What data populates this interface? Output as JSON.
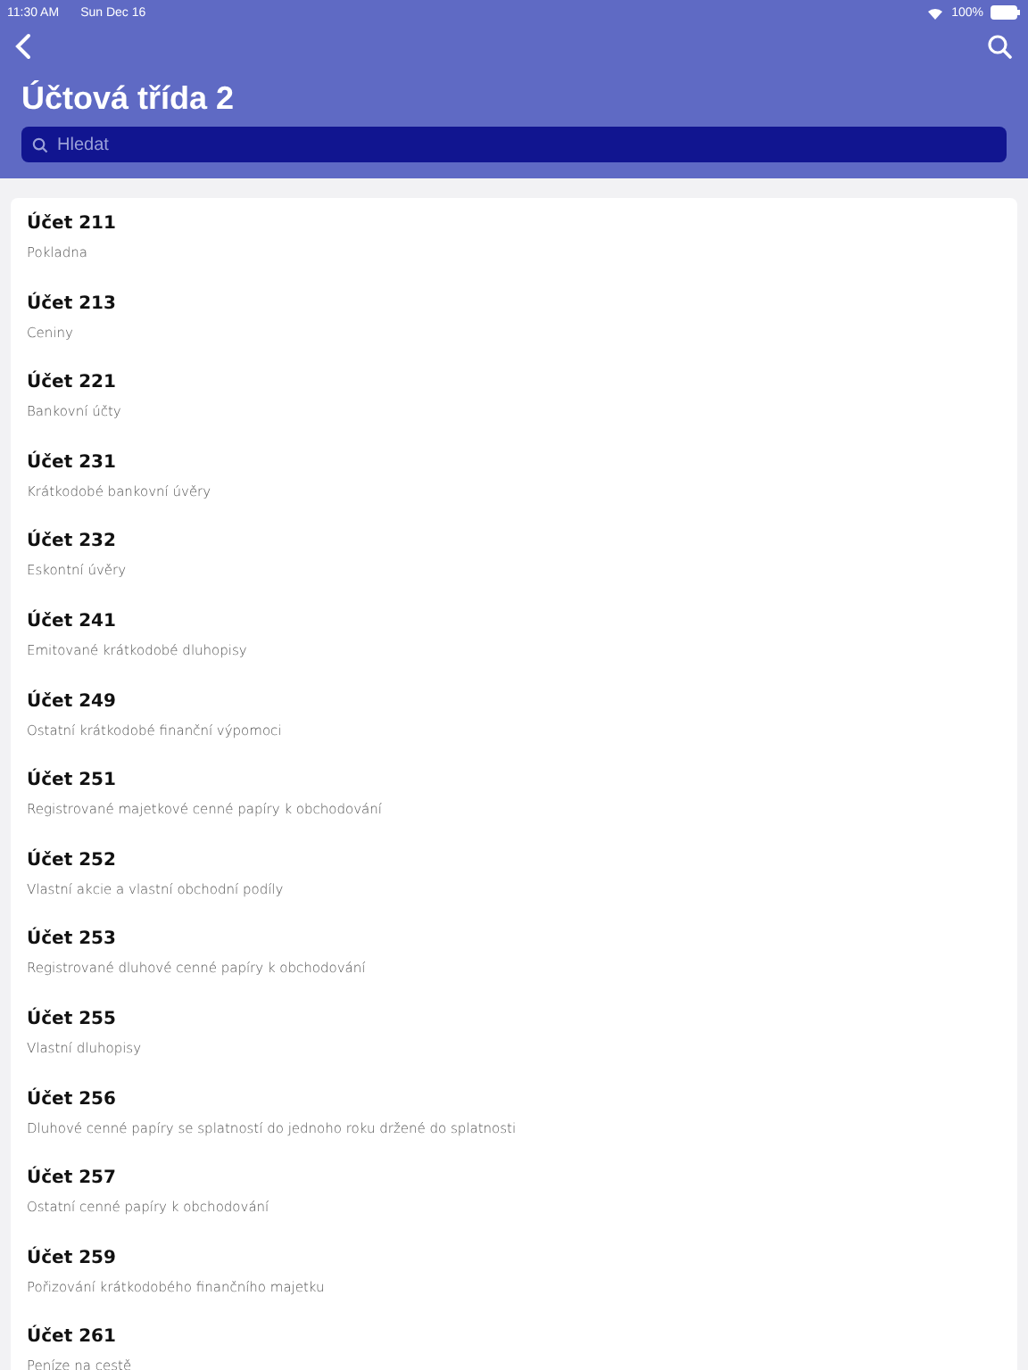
{
  "status_bar": {
    "time": "11:30 AM",
    "date": "Sun Dec 16",
    "battery": "100%"
  },
  "header": {
    "title": "Účtová třída 2",
    "search": {
      "placeholder": "Hledat"
    }
  },
  "accounts": [
    {
      "title": "Účet 211",
      "subtitle": "Pokladna"
    },
    {
      "title": "Účet 213",
      "subtitle": "Ceniny"
    },
    {
      "title": "Účet 221",
      "subtitle": "Bankovní účty"
    },
    {
      "title": "Účet 231",
      "subtitle": "Krátkodobé bankovní úvěry"
    },
    {
      "title": "Účet 232",
      "subtitle": "Eskontní úvěry"
    },
    {
      "title": "Účet 241",
      "subtitle": "Emitované krátkodobé dluhopisy"
    },
    {
      "title": "Účet 249",
      "subtitle": "Ostatní krátkodobé finanční výpomoci"
    },
    {
      "title": "Účet 251",
      "subtitle": "Registrované majetkové cenné papíry k obchodování"
    },
    {
      "title": "Účet 252",
      "subtitle": "Vlastní akcie a vlastní obchodní podíly"
    },
    {
      "title": "Účet 253",
      "subtitle": "Registrované dluhové cenné papíry k obchodování"
    },
    {
      "title": "Účet 255",
      "subtitle": "Vlastní dluhopisy"
    },
    {
      "title": "Účet 256",
      "subtitle": "Dluhové cenné papíry se splatností do jednoho roku držené do splatnosti"
    },
    {
      "title": "Účet 257",
      "subtitle": "Ostatní cenné papíry k obchodování"
    },
    {
      "title": "Účet 259",
      "subtitle": "Pořizování krátkodobého finančního majetku"
    },
    {
      "title": "Účet 261",
      "subtitle": "Peníze na cestě"
    }
  ]
}
